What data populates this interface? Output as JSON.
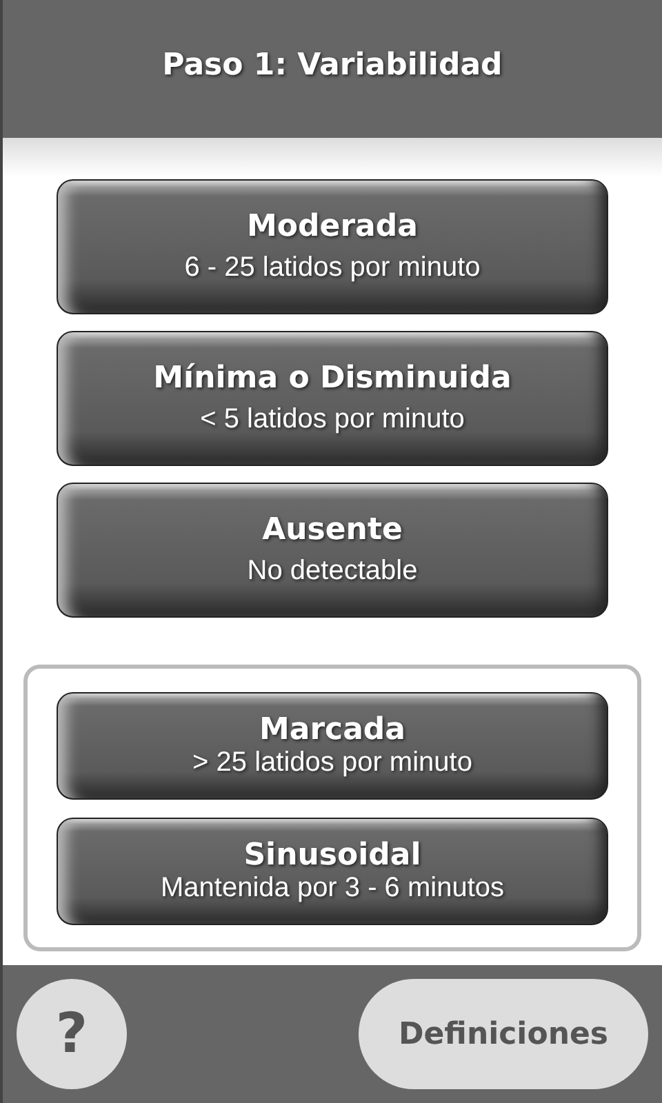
{
  "header": {
    "title": "Paso 1: Variabilidad"
  },
  "options": [
    {
      "title": "Moderada",
      "subtitle": "6 - 25 latidos por minuto"
    },
    {
      "title": "Mínima o Disminuida",
      "subtitle": "< 5 latidos por minuto"
    },
    {
      "title": "Ausente",
      "subtitle": "No detectable"
    }
  ],
  "grouped_options": [
    {
      "title": "Marcada",
      "subtitle": "> 25 latidos por minuto"
    },
    {
      "title": "Sinusoidal",
      "subtitle": "Mantenida por 3 - 6 minutos"
    }
  ],
  "footer": {
    "help_label": "?",
    "definitions_label": "Definiciones"
  }
}
